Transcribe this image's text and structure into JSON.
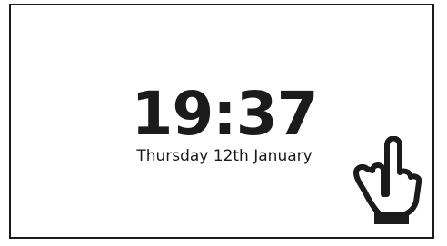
{
  "lock_screen": {
    "time": "19:37",
    "date": "Thursday 12th January",
    "icon": "pointing-hand-icon"
  },
  "colors": {
    "foreground": "#1b1b1b",
    "background": "#ffffff"
  }
}
